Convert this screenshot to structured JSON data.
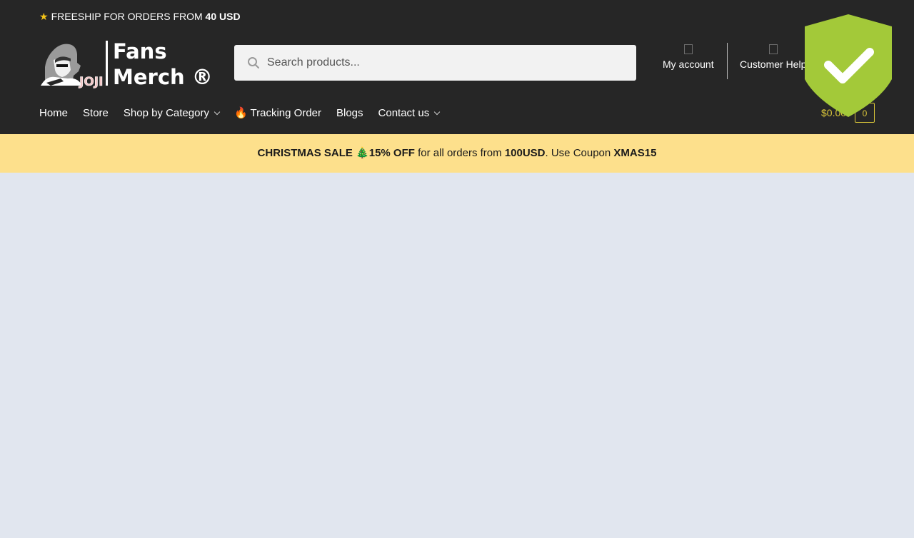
{
  "topbar": {
    "star_icon": "star-icon",
    "text": "FREESHIP FOR ORDERS FROM",
    "amount": "40 USD"
  },
  "logo": {
    "line1": "Fans",
    "line2": "Merch ®",
    "mascot_text": "JOJI"
  },
  "search": {
    "placeholder": "Search products...",
    "value": ""
  },
  "account": {
    "my_account": "My account",
    "customer_help": "Customer Help"
  },
  "nav": {
    "home": "Home",
    "store": "Store",
    "shop_by_category": "Shop by Category",
    "tracking_order": "🔥 Tracking Order",
    "blogs": "Blogs",
    "contact_us": "Contact us"
  },
  "cart": {
    "total": "$0.00",
    "count": "0"
  },
  "promo": {
    "label": "CHRISTMAS SALE",
    "tree": "🎄",
    "discount": "15% OFF",
    "middle": "for all orders from",
    "threshold": "100USD",
    "coupon_prefix": ". Use Coupon",
    "coupon": "XMAS15"
  },
  "colors": {
    "header_bg": "#262626",
    "promo_bg": "#fde08c",
    "main_bg": "#e1e6ef",
    "shield": "#a3c939",
    "cart_accent": "#d9c53a"
  }
}
